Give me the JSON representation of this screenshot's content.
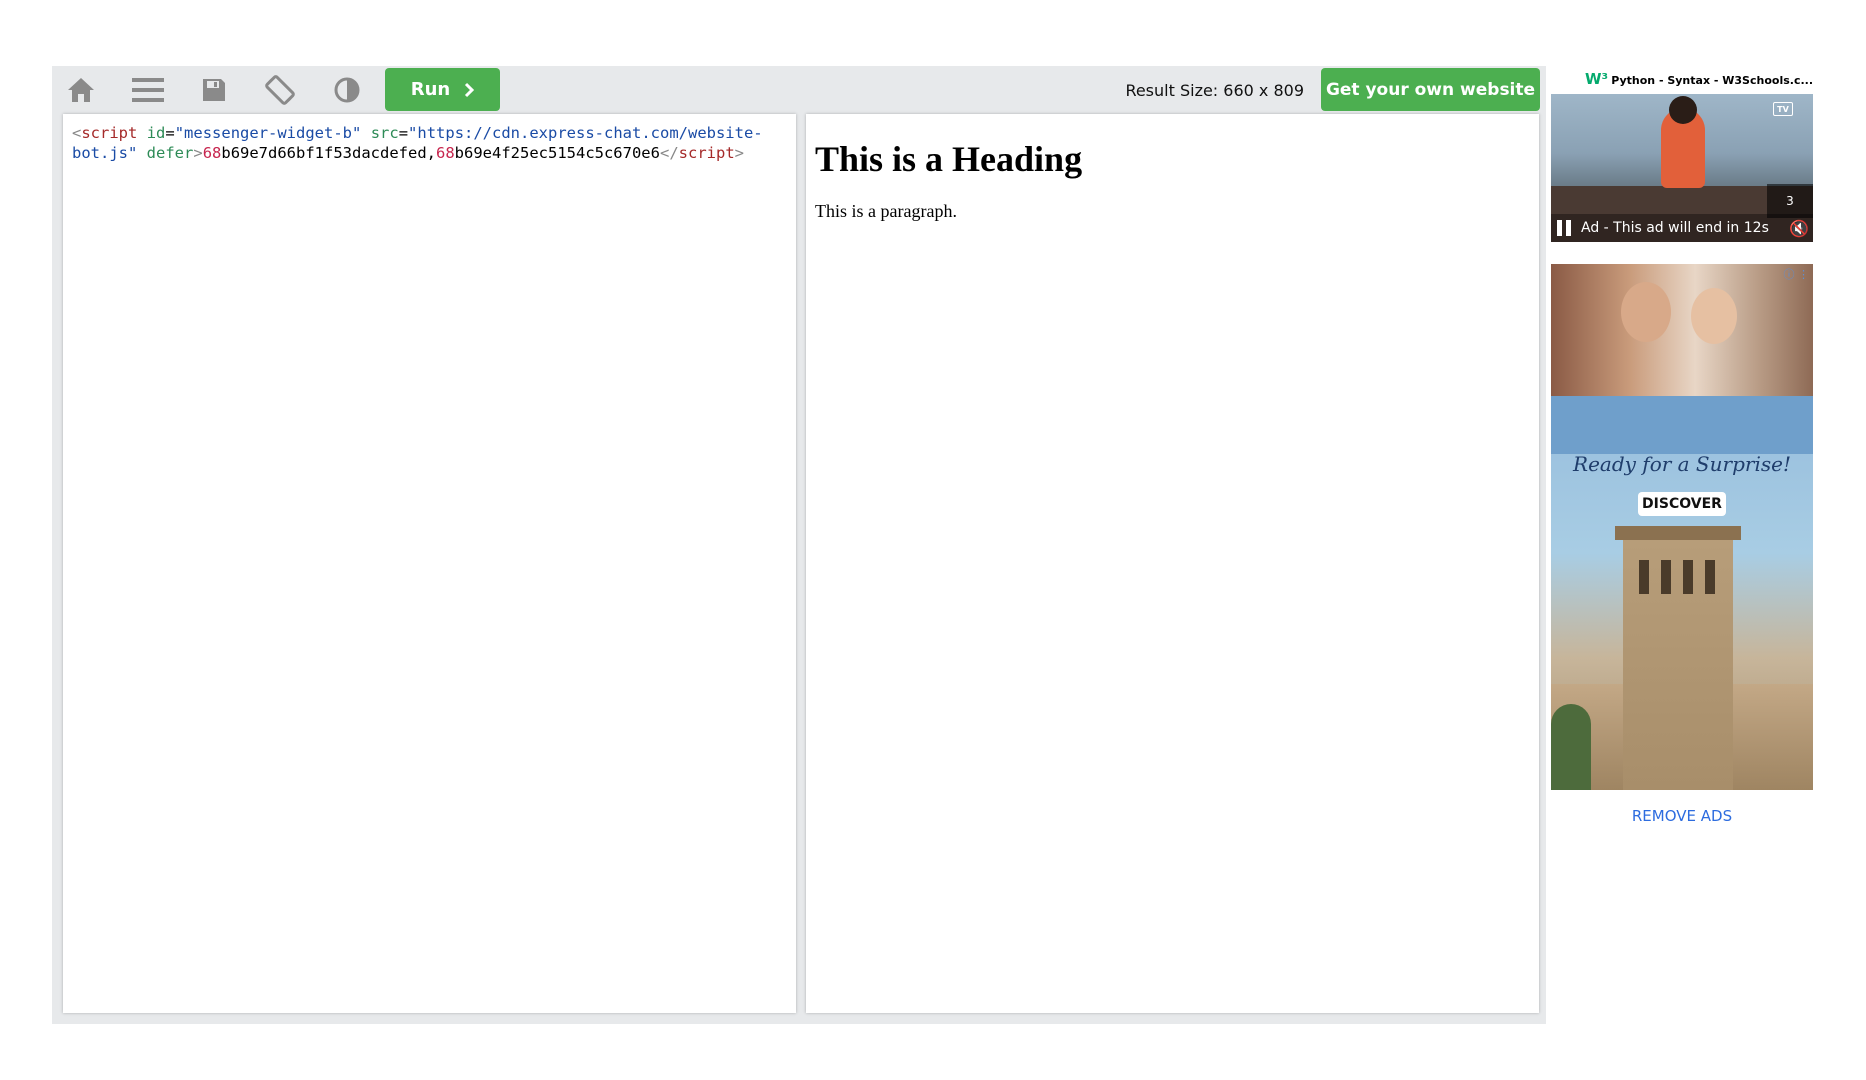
{
  "toolbar": {
    "icons": [
      "home-icon",
      "menu-icon",
      "save-icon",
      "rotate-icon",
      "contrast-icon"
    ],
    "run_label": "Run",
    "result_size": "Result Size: 660 x 809",
    "own_website_label": "Get your own website"
  },
  "editor": {
    "code": {
      "open_bracket": "<",
      "tag_open": "script",
      "space1": " ",
      "attr_id": "id",
      "eq1": "=",
      "val_id": "\"messenger-widget-b\"",
      "space2": " ",
      "attr_src": "src",
      "eq2": "=",
      "val_src": "\"https://cdn.express-chat.com/website-bot.js\"",
      "space3": " ",
      "attr_defer": "defer",
      "close_bracket": ">",
      "num1": "68",
      "text1": "b69e7d66bf1f53dacdefed,",
      "num2": "68",
      "text2": "b69e4f25ec5154c5c670e6",
      "end_open": "</",
      "tag_close": "script",
      "end_close": ">"
    }
  },
  "result": {
    "heading": "This is a Heading",
    "paragraph": "This is a paragraph."
  },
  "ads": {
    "video_ad": {
      "logo": "W³",
      "title": "Python - Syntax - W3Schools.c...",
      "tv_badge": "TV",
      "countdown": "3",
      "status": "Ad - This ad will end in 12s"
    },
    "display_ad": {
      "info": "ⓘ ⋮",
      "tagline": "Ready for a Surprise!",
      "button": "DISCOVER"
    },
    "remove_ads": "REMOVE ADS"
  },
  "colors": {
    "accent_green": "#4caf50",
    "toolbar_bg": "#e7e9eb",
    "link_blue": "#2d6cdf"
  }
}
